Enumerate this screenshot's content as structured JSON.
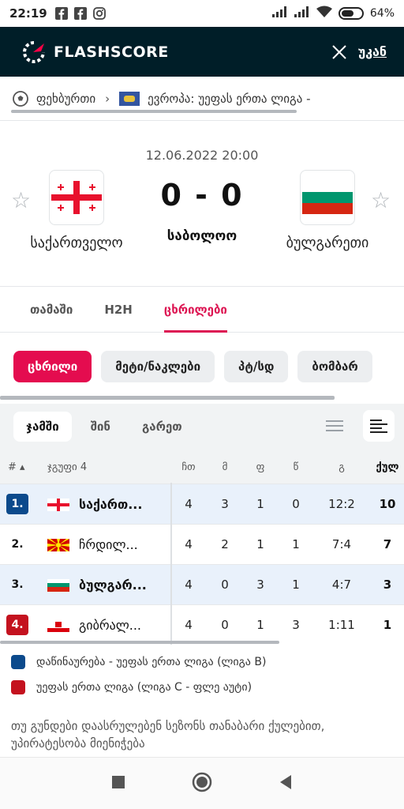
{
  "status_bar": {
    "time": "22:19",
    "battery": "64%",
    "battery_level": 0.64,
    "icons": [
      "facebook-icon",
      "facebook-icon",
      "instagram-icon",
      "signal-icon",
      "signal-icon",
      "wifi-icon",
      "battery-icon"
    ]
  },
  "app_bar": {
    "logo_text": "FLASHSCORE",
    "back_label": "უკან",
    "bg_color": "#001e28"
  },
  "breadcrumb": {
    "sport": "ფეხბურთი",
    "competition": "ევროპა: უეფას ერთა ლიგა -"
  },
  "match": {
    "datetime": "12.06.2022 20:00",
    "home_team": "საქართველო",
    "away_team": "ბულგარეთი",
    "score": "0 - 0",
    "status": "საბოლოო"
  },
  "tabs": [
    {
      "label": "თამაში"
    },
    {
      "label": "H2H"
    },
    {
      "label": "ცხრილები",
      "active": true
    }
  ],
  "pills": [
    {
      "label": "ცხრილი",
      "active": true
    },
    {
      "label": "მეტი/ნაკლები"
    },
    {
      "label": "პტ/სდ"
    },
    {
      "label": "ბომბარ"
    }
  ],
  "subtabs": [
    {
      "label": "ჯამში",
      "active": true
    },
    {
      "label": "შინ"
    },
    {
      "label": "გარეთ"
    }
  ],
  "table": {
    "headers": {
      "rank": "# ▴",
      "group": "ჯგუფი 4",
      "played": "ჩთ",
      "wins": "მ",
      "draws": "ფ",
      "losses": "წ",
      "goals": "გ",
      "points": "ქულ"
    },
    "rows": [
      {
        "rank": "1.",
        "team": "საქართ...",
        "played": "4",
        "wins": "3",
        "draws": "1",
        "losses": "0",
        "goals": "12:2",
        "points": "10",
        "highlight": true,
        "zone": "blue",
        "flag": "geo"
      },
      {
        "rank": "2.",
        "team": "ჩრდილ...",
        "played": "4",
        "wins": "2",
        "draws": "1",
        "losses": "1",
        "goals": "7:4",
        "points": "7",
        "highlight": false,
        "zone": "none",
        "flag": "mkd"
      },
      {
        "rank": "3.",
        "team": "ბულგარ...",
        "played": "4",
        "wins": "0",
        "draws": "3",
        "losses": "1",
        "goals": "4:7",
        "points": "3",
        "highlight": true,
        "zone": "none",
        "flag": "bgr"
      },
      {
        "rank": "4.",
        "team": "გიბრალ...",
        "played": "4",
        "wins": "0",
        "draws": "1",
        "losses": "3",
        "goals": "1:11",
        "points": "1",
        "highlight": false,
        "zone": "red",
        "flag": "gib"
      }
    ]
  },
  "legend": [
    {
      "label": "დაწინაურება - უეფას ერთა ლიგა (ლიგა B)",
      "color": "#0c4a8c"
    },
    {
      "label": "უეფას ერთა ლიგა (ლიგა C - ფლე აუტი)",
      "color": "#c4121f"
    }
  ],
  "note": "თუ გუნდები დაასრულებენ სეზონს თანაბარი ქულებით, უპირატესობა მიენიჭება",
  "colors": {
    "accent": "#dd1653",
    "pill_active": "#e40c4f",
    "highlight_row": "#e9f1fb"
  }
}
